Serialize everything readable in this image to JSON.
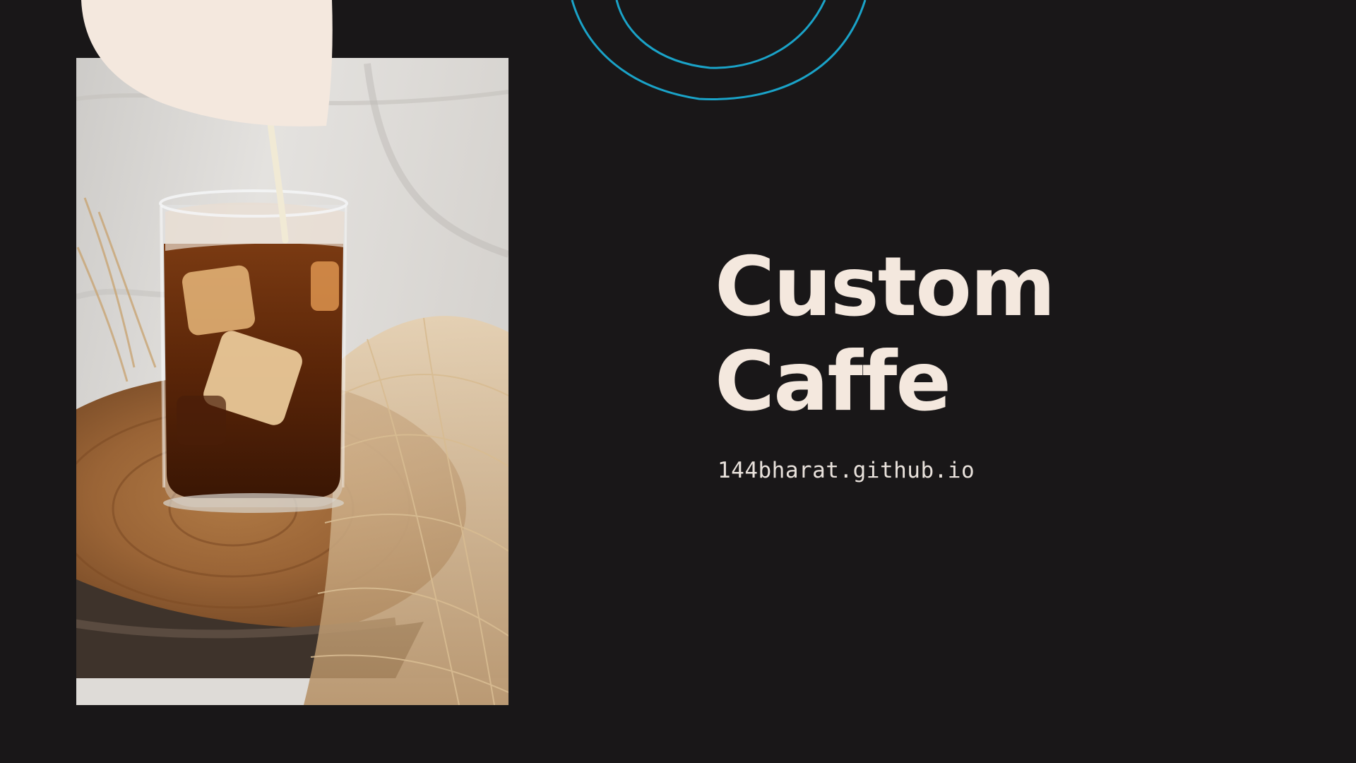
{
  "hero": {
    "title_line1": "Custom",
    "title_line2": "Caffe",
    "url": "144bharat.github.io"
  },
  "colors": {
    "background": "#191718",
    "title": "#f4e8de",
    "cream_blob": "#f4e8de",
    "accent_swirl": "#1aa3c8"
  },
  "icons": {
    "photo": "iced-coffee-photo",
    "decoration_blob": "cream-blob-shape",
    "decoration_swirl": "blue-swirl-lines"
  }
}
